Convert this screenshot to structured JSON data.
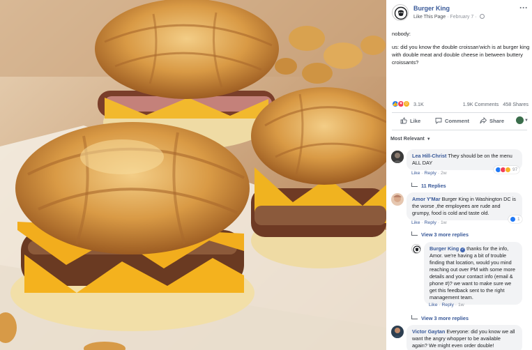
{
  "post": {
    "page_name": "Burger King",
    "like_page": "Like This Page",
    "separator": " · ",
    "date": "February 7",
    "more": "···",
    "text_line1": "nobody:",
    "text_line2": "us: did you know the double croissan'wich is at burger king with double meat and double cheese in between buttery croissants?",
    "reaction_count": "3.1K",
    "comments_count": "1.9K Comments",
    "shares_count": "458 Shares",
    "actions": {
      "like": "Like",
      "comment": "Comment",
      "share": "Share"
    },
    "sort_label": "Most Relevant"
  },
  "icons": {
    "like": "thumbs-up-icon",
    "love": "heart-icon",
    "haha": "laugh-icon",
    "comment": "speech-bubble-icon",
    "share": "share-arrow-icon",
    "globe": "globe-icon",
    "caret": "chevron-down-icon"
  },
  "colors": {
    "link_blue": "#385898",
    "like_blue": "#2078f4",
    "love_red": "#f33e58",
    "haha_yellow": "#f7b125",
    "bubble_gray": "#f2f3f5"
  },
  "comments": [
    {
      "author": "Lea Hill-Christ",
      "text": "They should be on the menu ALL DAY",
      "like": "Like",
      "reply": "Reply",
      "time": "2w",
      "reaction_count": "97",
      "replies": "11 Replies"
    },
    {
      "author": "Amor Y'Mar",
      "text": "Burger King in Washington DC is the worse ,the employees are rude and grumpy, food is cold and taste old.",
      "like": "Like",
      "reply": "Reply",
      "time": "1w",
      "reaction_count": "1",
      "replies": "View 3 more replies"
    },
    {
      "author": "Burger King",
      "text": "thanks for the info, Amor. we're having a bit of trouble finding that location, would you mind reaching out over PM with some more details and your contact info (email & phone #)? we want to make sure we get this feedback sent to the right management team.",
      "like": "Like",
      "reply": "Reply",
      "time": "1w",
      "replies": "View 3 more replies"
    },
    {
      "author": "Victor Gaytan",
      "text": "Everyone: did you know we all want the angry whopper to be available again? We might even order double!"
    }
  ],
  "actions_sep": " · "
}
